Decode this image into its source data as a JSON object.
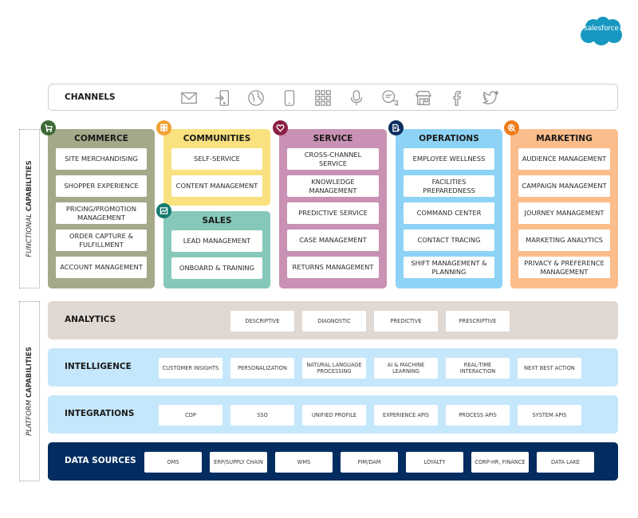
{
  "logo": {
    "text": "salesforce",
    "color": "#1798c1"
  },
  "channels": {
    "label": "CHANNELS",
    "icons": [
      "email-icon",
      "login-icon",
      "globe-icon",
      "mobile-icon",
      "app-grid-icon",
      "microphone-icon",
      "chat-icon",
      "storefront-icon",
      "facebook-icon",
      "twitter-icon"
    ]
  },
  "side_labels": {
    "functional": {
      "italic": "FUNCTIONAL ",
      "bold": "CAPABILITIES"
    },
    "platform": {
      "italic": "PLATFORM ",
      "bold": "CAPABILITIES"
    }
  },
  "functional": {
    "commerce": {
      "title": "COMMERCE",
      "color": "#a4a98a",
      "badge_color": "#3e6b35",
      "icon": "cart-icon",
      "items": [
        "SITE MERCHANDISING",
        "SHOPPER EXPERIENCE",
        "PRICING/PROMOTION MANAGEMENT",
        "ORDER CAPTURE & FULFILLMENT",
        "ACCOUNT MANAGEMENT"
      ]
    },
    "communities": {
      "title": "COMMUNITIES",
      "color": "#f9e17f",
      "badge_color": "#f0a336",
      "icon": "community-icon",
      "items": [
        "SELF-SERVICE",
        "CONTENT MANAGEMENT"
      ]
    },
    "sales": {
      "title": "SALES",
      "color": "#86c8ba",
      "badge_color": "#157a6e",
      "icon": "chart-icon",
      "items": [
        "LEAD MANAGEMENT",
        "ONBOARD & TRAINING"
      ]
    },
    "service": {
      "title": "SERVICE",
      "color": "#c991b3",
      "badge_color": "#8a1f44",
      "icon": "heart-icon",
      "items": [
        "CROSS-CHANNEL SERVICE",
        "KNOWLEDGE MANAGEMENT",
        "PREDICTIVE SERVICE",
        "CASE MANAGEMENT",
        "RETURNS MANAGEMENT"
      ]
    },
    "operations": {
      "title": "OPERATIONS",
      "color": "#8dd3f6",
      "badge_color": "#0d2f5e",
      "icon": "document-icon",
      "items": [
        "EMPLOYEE WELLNESS",
        "FACILITIES PREPAREDNESS",
        "COMMAND CENTER",
        "CONTACT TRACING",
        "SHIFT MANAGEMENT & PLANNING"
      ]
    },
    "marketing": {
      "title": "MARKETING",
      "color": "#fbbd8b",
      "badge_color": "#ed7d1b",
      "icon": "audience-search-icon",
      "items": [
        "AUDIENCE MANAGEMENT",
        "CAMPAIGN MANAGEMENT",
        "JOURNEY MANAGEMENT",
        "MARKETING ANALYTICS",
        "PRIVACY & PREFERENCE MANAGEMENT"
      ]
    }
  },
  "platform": {
    "analytics": {
      "label": "ANALYTICS",
      "color": "#e0d8d2",
      "items": [
        "DESCRIPTIVE",
        "DIAGNOSTIC",
        "PREDICTIVE",
        "PRESCRIPTIVE"
      ]
    },
    "intelligence": {
      "label": "INTELLIGENCE",
      "color": "#c5e7fb",
      "items": [
        "CUSTOMER INSIGHTS",
        "PERSONALIZATION",
        "NATURAL LANGUAGE PROCESSING",
        "AI & MACHINE LEARNING",
        "REAL-TIME INTERACTION",
        "NEXT BEST ACTION"
      ]
    },
    "integrations": {
      "label": "INTEGRATIONS",
      "color": "#c5e7fb",
      "items": [
        "CDP",
        "SSO",
        "UNIFIED PROFILE",
        "EXPERIENCE APIS",
        "PROCESS APIS",
        "SYSTEM APIS"
      ]
    },
    "data_sources": {
      "label": "DATA SOURCES",
      "color": "#032d60",
      "items": [
        "OMS",
        "ERP/SUPPLY CHAIN",
        "WMS",
        "PIM/DAM",
        "LOYALTY",
        "CORP-HR, FINANCE",
        "DATA LAKE"
      ]
    }
  }
}
